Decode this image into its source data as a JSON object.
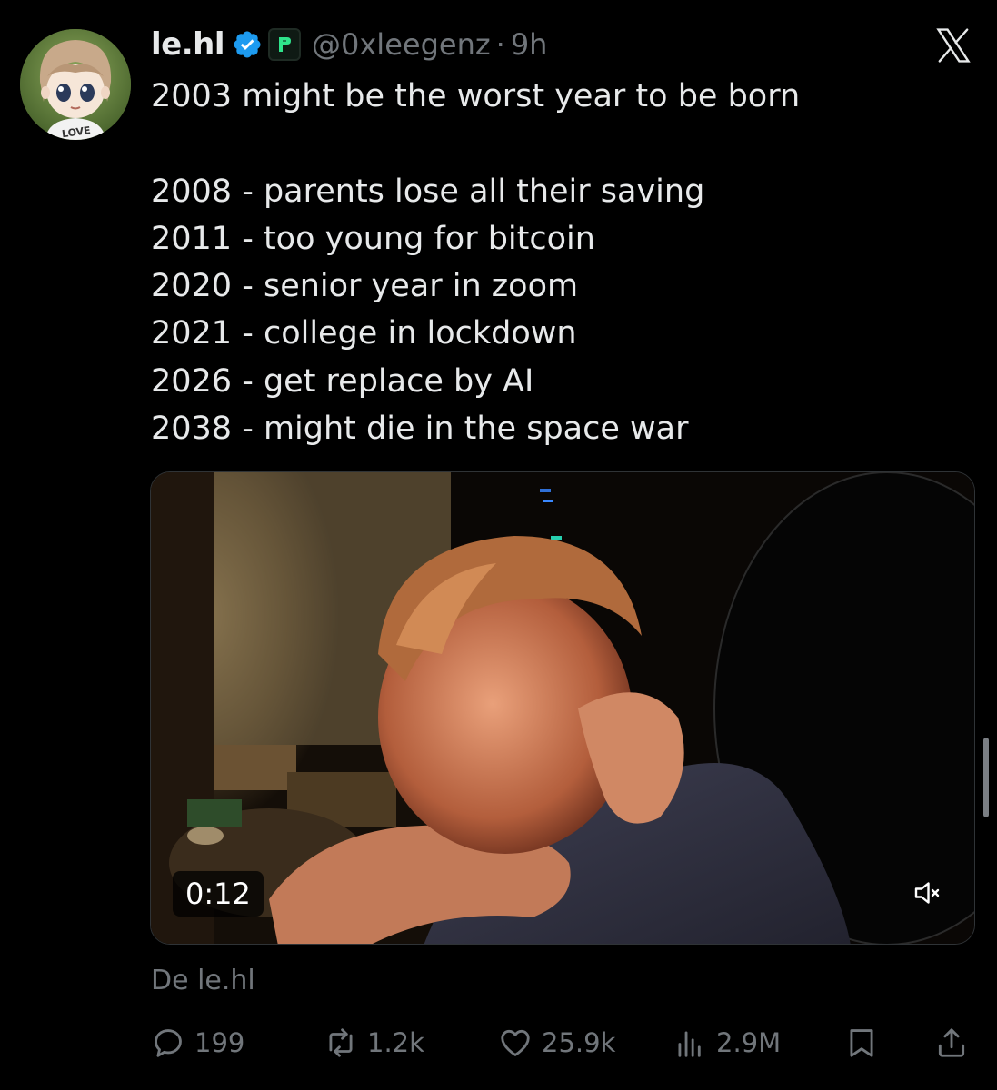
{
  "tweet": {
    "display_name": "le.hl",
    "handle": "@0xleegenz",
    "separator": "·",
    "time": "9h",
    "avatar_shirt_text": "LOVE",
    "text_lines": [
      "2003 might be the worst year to be born",
      "",
      "2008 - parents lose all their saving",
      "2011 - too young for bitcoin",
      "2020 - senior year in zoom",
      "2021 - college in lockdown",
      "2026 - get replace by AI",
      "2038 - might die in the space war"
    ],
    "video": {
      "duration": "0:12",
      "muted": true
    },
    "from_label": "De le.hl"
  },
  "actions": {
    "replies": "199",
    "reposts": "1.2k",
    "likes": "25.9k",
    "views": "2.9M"
  },
  "icons": {
    "verified": "verified-badge-icon",
    "affiliate": "affiliate-badge-icon",
    "brand": "x-logo-icon",
    "reply": "reply-icon",
    "repost": "repost-icon",
    "like": "heart-icon",
    "views": "views-icon",
    "bookmark": "bookmark-icon",
    "share": "share-icon",
    "mute": "speaker-muted-icon"
  },
  "colors": {
    "background": "#000000",
    "text": "#e7e9ea",
    "secondary": "#71767b",
    "verified": "#1d9bf0",
    "affiliate_accent": "#2fe38b"
  }
}
